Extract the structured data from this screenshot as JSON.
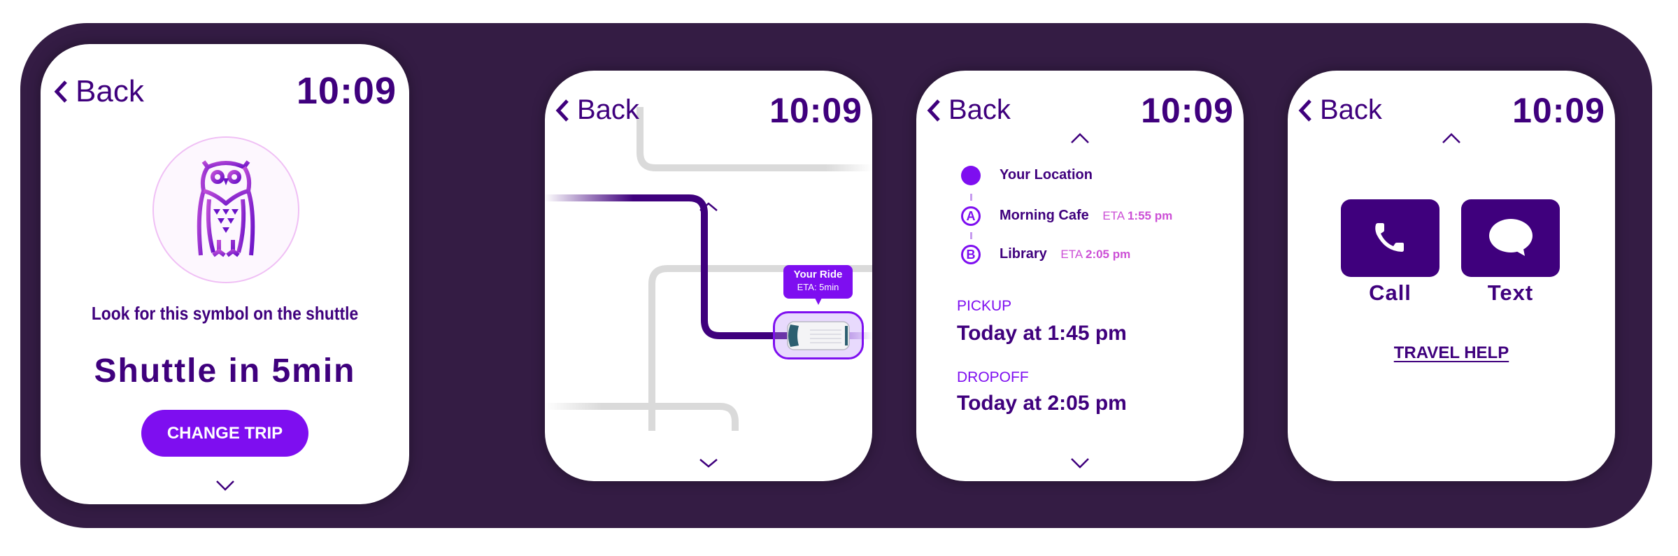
{
  "colors": {
    "frame": "#341c44",
    "primary_dark": "#3f007d",
    "accent": "#7e0ef0",
    "eta_pink": "#cc4fd6",
    "road_gray": "#dadada"
  },
  "screens": [
    {
      "id": "shuttle-status",
      "back_label": "Back",
      "time": "10:09",
      "symbol_icon": "owl-icon",
      "tagline": "Look for this symbol on the shuttle",
      "headline": "Shuttle in 5min",
      "button_label": "CHANGE TRIP",
      "scroll_down_icon": "chevron-down-icon"
    },
    {
      "id": "map",
      "back_label": "Back",
      "time": "10:09",
      "bubble_title": "Your Ride",
      "bubble_eta": "ETA: 5min",
      "vehicle_icon": "van-icon"
    },
    {
      "id": "trip-details",
      "back_label": "Back",
      "time": "10:09",
      "stops": [
        {
          "marker": "",
          "name": "Your Location",
          "eta_label": "",
          "eta_time": ""
        },
        {
          "marker": "A",
          "name": "Morning Cafe",
          "eta_label": "ETA",
          "eta_time": "1:55 pm"
        },
        {
          "marker": "B",
          "name": "Library",
          "eta_label": "ETA",
          "eta_time": "2:05 pm"
        }
      ],
      "pickup_label": "PICKUP",
      "pickup_value": "Today at 1:45 pm",
      "dropoff_label": "DROPOFF",
      "dropoff_value": "Today at 2:05 pm"
    },
    {
      "id": "contact",
      "back_label": "Back",
      "time": "10:09",
      "call_label": "Call",
      "text_label": "Text",
      "help_link": "TRAVEL HELP"
    }
  ]
}
